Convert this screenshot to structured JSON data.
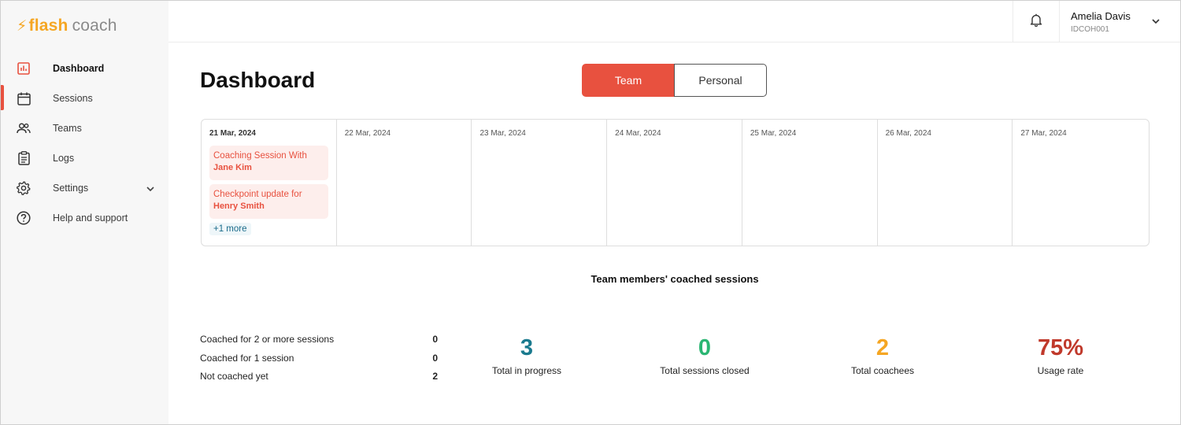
{
  "app": {
    "logo_bolt": "⚡",
    "logo_flash": "flash",
    "logo_coach": "coach",
    "brand_color": "#f5a623",
    "accent_color": "#e8513f"
  },
  "sidebar": {
    "items": [
      {
        "label": "Dashboard",
        "icon": "bar-chart-icon"
      },
      {
        "label": "Sessions",
        "icon": "calendar-icon"
      },
      {
        "label": "Teams",
        "icon": "people-icon"
      },
      {
        "label": "Logs",
        "icon": "clipboard-icon"
      },
      {
        "label": "Settings",
        "icon": "gear-icon"
      },
      {
        "label": "Help and support",
        "icon": "question-circle-icon"
      }
    ]
  },
  "header": {
    "user_name": "Amelia Davis",
    "user_id": "IDCOH001"
  },
  "main": {
    "title": "Dashboard",
    "toggle": {
      "team": "Team",
      "personal": "Personal",
      "selected": "Team"
    },
    "calendar": {
      "days": [
        {
          "date": "21 Mar, 2024"
        },
        {
          "date": "22 Mar, 2024"
        },
        {
          "date": "23 Mar, 2024"
        },
        {
          "date": "24 Mar, 2024"
        },
        {
          "date": "25 Mar, 2024"
        },
        {
          "date": "26 Mar, 2024"
        },
        {
          "date": "27 Mar, 2024"
        }
      ],
      "events": [
        {
          "title": "Coaching Session With",
          "who": "Jane Kim"
        },
        {
          "title": "Checkpoint update for",
          "who": "Henry Smith"
        }
      ],
      "more": "+1 more"
    },
    "section_title": "Team members' coached sessions",
    "breakdown": [
      {
        "label": "Coached for 2 or more sessions",
        "value": "0"
      },
      {
        "label": "Coached for 1 session",
        "value": "0"
      },
      {
        "label": "Not coached yet",
        "value": "2"
      }
    ],
    "stats": [
      {
        "value": "3",
        "caption": "Total in progress",
        "color": "#1a7a8e"
      },
      {
        "value": "0",
        "caption": "Total sessions closed",
        "color": "#2bb673"
      },
      {
        "value": "2",
        "caption": "Total coachees",
        "color": "#f5a623"
      },
      {
        "value": "75%",
        "caption": "Usage rate",
        "color": "#c0392b"
      }
    ]
  }
}
